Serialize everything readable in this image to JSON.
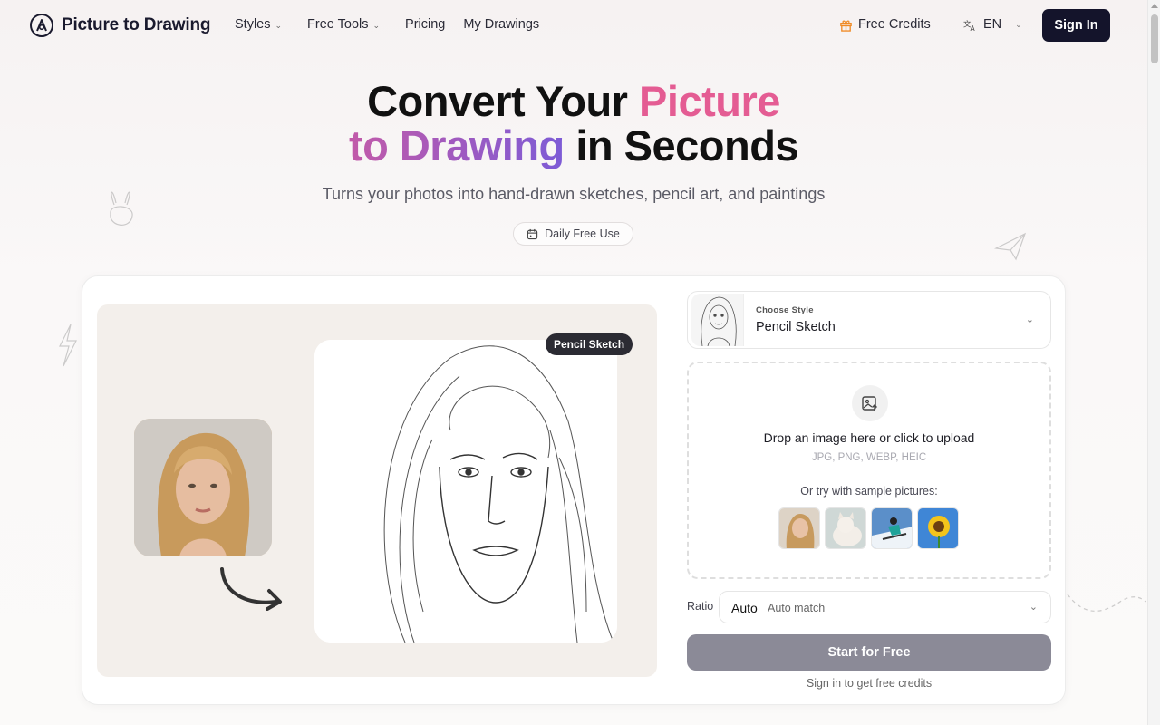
{
  "header": {
    "logo_text": "Picture to Drawing",
    "nav": [
      {
        "label": "Styles",
        "has_dropdown": true
      },
      {
        "label": "Free Tools",
        "has_dropdown": true
      },
      {
        "label": "Pricing",
        "has_dropdown": false
      },
      {
        "label": "My Drawings",
        "has_dropdown": false
      }
    ],
    "free_credits": "Free Credits",
    "language": "EN",
    "sign_in": "Sign In"
  },
  "hero": {
    "title_part1": "Convert Your ",
    "title_highlight1": "Picture",
    "title_highlight2": "to Drawing",
    "title_part2": " in Seconds",
    "subtitle": "Turns your photos into hand-drawn sketches, pencil art, and paintings",
    "badge": "Daily Free Use"
  },
  "demo": {
    "tag": "Pencil Sketch"
  },
  "panel": {
    "style_label": "Choose Style",
    "style_value": "Pencil Sketch",
    "upload_text": "Drop an image here or click to upload",
    "upload_formats": "JPG, PNG, WEBP, HEIC",
    "sample_text": "Or try with sample pictures:",
    "samples": [
      "woman-portrait",
      "cat",
      "skier",
      "sunflower"
    ],
    "ratio_label": "Ratio",
    "ratio_value": "Auto",
    "ratio_hint": "Auto match",
    "start_button": "Start for Free",
    "signin_hint": "Sign in to get free credits"
  },
  "colors": {
    "accent_pink": "#e45c93",
    "accent_purple": "#7d5bd6",
    "sign_in_bg": "#14142b",
    "start_button_bg": "#8b8a97",
    "gift_orange": "#f08a24"
  }
}
